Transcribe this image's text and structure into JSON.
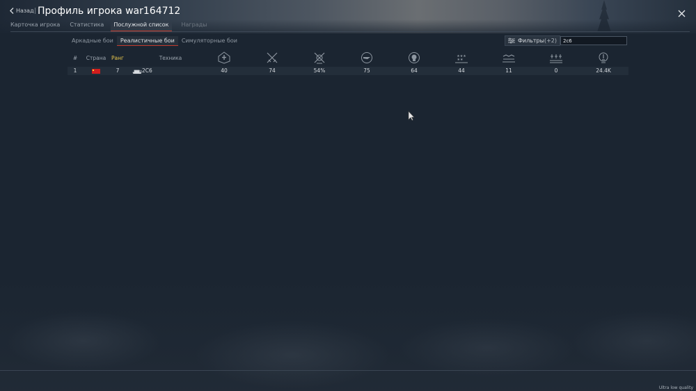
{
  "header": {
    "back_label": "Назад",
    "separator": "|",
    "title": "Профиль игрока war164712"
  },
  "tabs": [
    {
      "label": "Карточка игрока",
      "active": false
    },
    {
      "label": "Статистика",
      "active": false
    },
    {
      "label": "Послужной список",
      "active": true
    },
    {
      "label": "Награды",
      "active": false
    }
  ],
  "modes": [
    {
      "label": "Аркадные бои",
      "active": false
    },
    {
      "label": "Реалистичные бои",
      "active": true
    },
    {
      "label": "Симуляторные бои",
      "active": false
    }
  ],
  "filters": {
    "label": "Фильтры",
    "count": "(+2)",
    "search_value": "2с6"
  },
  "table": {
    "columns": {
      "num": "#",
      "country": "Страна",
      "rank": "Ранг",
      "vehicle": "Техника"
    },
    "stat_icons": [
      "battles-icon",
      "victories-icon",
      "win-rate-icon",
      "air-targets-icon",
      "destroyed-icon",
      "ground-targets-icon",
      "naval-targets-icon",
      "deaths-icon",
      "research-points-icon"
    ],
    "rows": [
      {
        "num": "1",
        "country_flag": "china-flag",
        "rank": "7",
        "vehicle_icon": "tank-icon",
        "vehicle": "2С6",
        "stats": [
          "40",
          "74",
          "54%",
          "75",
          "64",
          "44",
          "11",
          "0",
          "24.4K"
        ]
      }
    ]
  },
  "footer": {
    "quality": "Ultra low quality"
  },
  "colors": {
    "background": "#1b2531",
    "accent": "#c23a2c",
    "rank": "#e7c64c"
  }
}
